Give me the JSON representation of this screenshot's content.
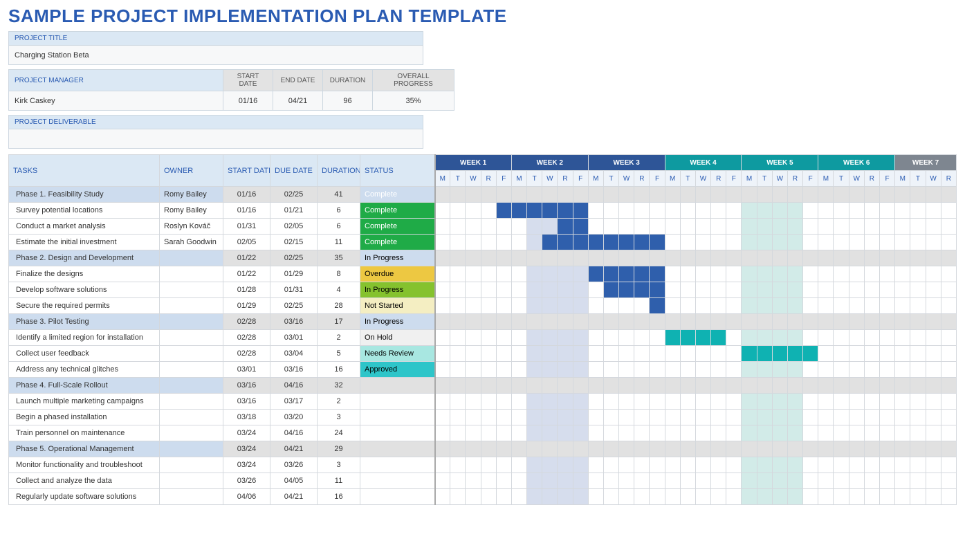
{
  "title": "SAMPLE PROJECT IMPLEMENTATION PLAN TEMPLATE",
  "labels": {
    "project_title": "PROJECT TITLE",
    "project_manager": "PROJECT MANAGER",
    "start_date": "START DATE",
    "end_date": "END DATE",
    "duration": "DURATION",
    "overall_progress": "OVERALL PROGRESS",
    "project_deliverable": "PROJECT DELIVERABLE",
    "tasks": "TASKS",
    "owner": "OWNER",
    "due_date": "DUE DATE",
    "status": "STATUS"
  },
  "project": {
    "title": "Charging Station Beta",
    "manager": "Kirk Caskey",
    "start": "01/16",
    "end": "04/21",
    "duration": "96",
    "progress": "35%",
    "deliverable": ""
  },
  "weeks": [
    {
      "label": "WEEK 1",
      "cls": "a",
      "stripe": "a",
      "days": [
        "M",
        "T",
        "W",
        "R",
        "F"
      ]
    },
    {
      "label": "WEEK 2",
      "cls": "a",
      "stripe": "a",
      "days": [
        "M",
        "T",
        "W",
        "R",
        "F"
      ]
    },
    {
      "label": "WEEK 3",
      "cls": "a",
      "stripe": "a",
      "days": [
        "M",
        "T",
        "W",
        "R",
        "F"
      ]
    },
    {
      "label": "WEEK 4",
      "cls": "b",
      "stripe": "b",
      "days": [
        "M",
        "T",
        "W",
        "R",
        "F"
      ]
    },
    {
      "label": "WEEK 5",
      "cls": "b",
      "stripe": "b",
      "days": [
        "M",
        "T",
        "W",
        "R",
        "F"
      ]
    },
    {
      "label": "WEEK 6",
      "cls": "b",
      "stripe": "b",
      "days": [
        "M",
        "T",
        "W",
        "R",
        "F"
      ]
    },
    {
      "label": "WEEK 7",
      "cls": "c",
      "stripe": "",
      "days": [
        "M",
        "T",
        "W",
        "R"
      ]
    }
  ],
  "stripe_cols": {
    "a": [
      6,
      7,
      8,
      9
    ],
    "b": [
      20,
      21,
      22,
      23
    ]
  },
  "rows": [
    {
      "type": "phase",
      "task": "Phase 1.  Feasibility Study",
      "owner": "Romy Bailey",
      "start": "01/16",
      "due": "02/25",
      "dur": "41",
      "status": "Complete",
      "status_cls": "st-complete"
    },
    {
      "type": "task",
      "task": "Survey potential locations",
      "owner": "Romy Bailey",
      "start": "01/16",
      "due": "01/21",
      "dur": "6",
      "status": "Complete",
      "status_cls": "st-complete",
      "bar": {
        "start": 4,
        "end": 9,
        "cls": "a"
      }
    },
    {
      "type": "task",
      "task": "Conduct a market analysis",
      "owner": "Roslyn Kováč",
      "start": "01/31",
      "due": "02/05",
      "dur": "6",
      "status": "Complete",
      "status_cls": "st-complete",
      "bar": {
        "start": 8,
        "end": 9,
        "cls": "a"
      }
    },
    {
      "type": "task",
      "task": "Estimate the initial investment",
      "owner": "Sarah Goodwin",
      "start": "02/05",
      "due": "02/15",
      "dur": "11",
      "status": "Complete",
      "status_cls": "st-complete",
      "bar": {
        "start": 7,
        "end": 14,
        "cls": "a"
      }
    },
    {
      "type": "phase",
      "task": "Phase 2.  Design and Development",
      "owner": "",
      "start": "01/22",
      "due": "02/25",
      "dur": "35",
      "status": "In Progress",
      "status_cls": "st-inprogress"
    },
    {
      "type": "task",
      "task": "Finalize the designs",
      "owner": "",
      "start": "01/22",
      "due": "01/29",
      "dur": "8",
      "status": "Overdue",
      "status_cls": "st-overdue",
      "bar": {
        "start": 10,
        "end": 14,
        "cls": "a"
      }
    },
    {
      "type": "task",
      "task": "Develop software solutions",
      "owner": "",
      "start": "01/28",
      "due": "01/31",
      "dur": "4",
      "status": "In Progress",
      "status_cls": "st-inprogress",
      "bar": {
        "start": 11,
        "end": 14,
        "cls": "a"
      }
    },
    {
      "type": "task",
      "task": "Secure the required permits",
      "owner": "",
      "start": "01/29",
      "due": "02/25",
      "dur": "28",
      "status": "Not Started",
      "status_cls": "st-notstarted",
      "tail": {
        "col": 14,
        "cls": "a"
      }
    },
    {
      "type": "phase",
      "task": "Phase 3.  Pilot Testing",
      "owner": "",
      "start": "02/28",
      "due": "03/16",
      "dur": "17",
      "status": "In Progress",
      "status_cls": "st-inprogress"
    },
    {
      "type": "task",
      "task": "Identify a limited region for installation",
      "owner": "",
      "start": "02/28",
      "due": "03/01",
      "dur": "2",
      "status": "On Hold",
      "status_cls": "st-onhold",
      "bar": {
        "start": 15,
        "end": 18,
        "cls": "b"
      }
    },
    {
      "type": "task",
      "task": "Collect user feedback",
      "owner": "",
      "start": "02/28",
      "due": "03/04",
      "dur": "5",
      "status": "Needs Review",
      "status_cls": "st-needsreview",
      "bar": {
        "start": 20,
        "end": 24,
        "cls": "b"
      }
    },
    {
      "type": "task",
      "task": "Address any technical glitches",
      "owner": "",
      "start": "03/01",
      "due": "03/16",
      "dur": "16",
      "status": "Approved",
      "status_cls": "st-approved"
    },
    {
      "type": "phase",
      "task": "Phase 4.  Full-Scale Rollout",
      "owner": "",
      "start": "03/16",
      "due": "04/16",
      "dur": "32",
      "status": "",
      "status_cls": ""
    },
    {
      "type": "task",
      "task": "Launch multiple marketing campaigns",
      "owner": "",
      "start": "03/16",
      "due": "03/17",
      "dur": "2",
      "status": "",
      "status_cls": ""
    },
    {
      "type": "task",
      "task": "Begin a phased installation",
      "owner": "",
      "start": "03/18",
      "due": "03/20",
      "dur": "3",
      "status": "",
      "status_cls": ""
    },
    {
      "type": "task",
      "task": "Train personnel on maintenance",
      "owner": "",
      "start": "03/24",
      "due": "04/16",
      "dur": "24",
      "status": "",
      "status_cls": ""
    },
    {
      "type": "phase",
      "task": "Phase 5.  Operational Management",
      "owner": "",
      "start": "03/24",
      "due": "04/21",
      "dur": "29",
      "status": "",
      "status_cls": ""
    },
    {
      "type": "task",
      "task": "Monitor functionality and troubleshoot",
      "owner": "",
      "start": "03/24",
      "due": "03/26",
      "dur": "3",
      "status": "",
      "status_cls": ""
    },
    {
      "type": "task",
      "task": "Collect and analyze the data",
      "owner": "",
      "start": "03/26",
      "due": "04/05",
      "dur": "11",
      "status": "",
      "status_cls": ""
    },
    {
      "type": "task",
      "task": "Regularly update software solutions",
      "owner": "",
      "start": "04/06",
      "due": "04/21",
      "dur": "16",
      "status": "",
      "status_cls": ""
    }
  ]
}
